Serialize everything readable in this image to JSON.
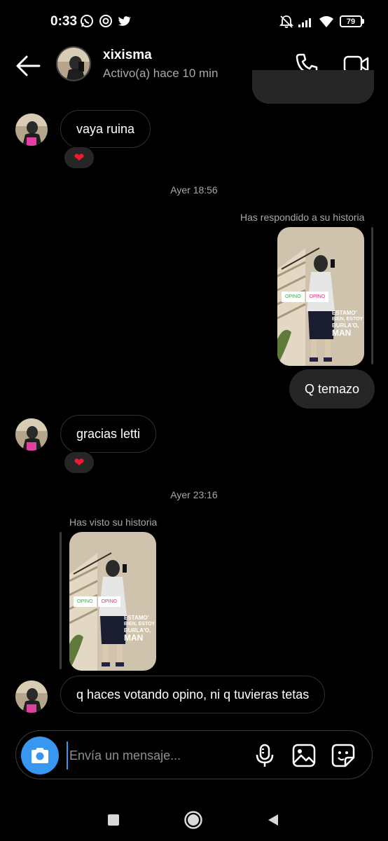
{
  "status_bar": {
    "time": "0:33",
    "battery": "79",
    "icons": [
      "whatsapp-icon",
      "privacy-icon",
      "twitter-icon",
      "mute-icon",
      "signal-icon",
      "wifi-icon",
      "battery-icon"
    ]
  },
  "header": {
    "name": "xixisma",
    "status": "Activo(a) hace 10 min",
    "icons": [
      "back-arrow-icon",
      "phone-icon",
      "video-camera-icon"
    ]
  },
  "messages": [
    {
      "type": "received",
      "text": "vaya ruina",
      "reaction": "❤"
    },
    {
      "type": "timestamp",
      "text": "Ayer 18:56"
    },
    {
      "type": "story_reply_caption",
      "text": "Has respondido a su historia"
    },
    {
      "type": "story",
      "stickers": [
        "OPINO",
        "OPINO"
      ],
      "overlay": [
        "ESTAMO'",
        "BIEN, ESTOY",
        "BURLA'O,",
        "MAN"
      ]
    },
    {
      "type": "sent",
      "text": "Q temazo"
    },
    {
      "type": "received",
      "text": "gracias letti",
      "reaction": "❤"
    },
    {
      "type": "timestamp",
      "text": "Ayer 23:16"
    },
    {
      "type": "story_seen_caption",
      "text": "Has visto su historia"
    },
    {
      "type": "story",
      "stickers": [
        "OPINO",
        "OPINO"
      ],
      "overlay": [
        "ESTAMO'",
        "BIEN, ESTOY",
        "BURLA'O,",
        "MAN"
      ]
    },
    {
      "type": "received",
      "text": "q haces votando opino, ni q tuvieras tetas"
    }
  ],
  "composer": {
    "placeholder": "Envía un mensaje...",
    "icons": [
      "camera-icon",
      "microphone-icon",
      "gallery-icon",
      "sticker-icon"
    ]
  },
  "nav_bar": {
    "icons": [
      "recents-square-icon",
      "home-circle-icon",
      "back-triangle-icon"
    ]
  },
  "colors": {
    "background": "#000000",
    "sent_bubble": "#262626",
    "received_border": "#2f2f2f",
    "accent": "#3897f0",
    "heart": "#ed1b2e",
    "muted_text": "#a8a8a8"
  }
}
